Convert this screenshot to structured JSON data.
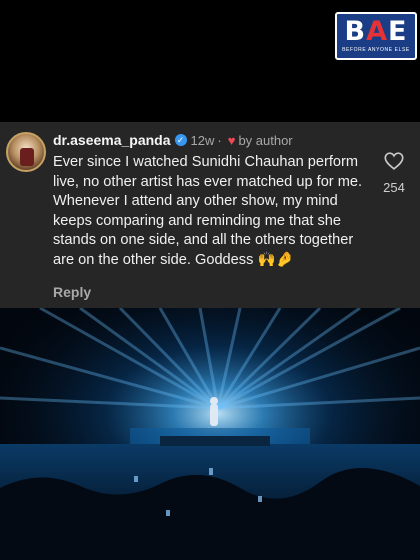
{
  "logo": {
    "word_prefix": "B",
    "word_accent": "A",
    "word_suffix": "E",
    "tagline": "BEFORE ANYONE ELSE"
  },
  "comment": {
    "username": "dr.aseema_panda",
    "time_ago": "12w",
    "separator": "·",
    "liked_by": "by author",
    "text": "Ever since I watched Sunidhi Chauhan perform live, no other artist has ever matched up for me. Whenever I attend any other show, my mind keeps comparing and reminding me that she stands on one side, and all the others together are on the other side. Goddess 🙌🤌",
    "reply_label": "Reply",
    "like_count": "254"
  },
  "colors": {
    "accent_blue": "#3897f0",
    "heart_red": "#ed4956",
    "logo_blue": "#1a3d86",
    "card_bg": "#262626"
  }
}
